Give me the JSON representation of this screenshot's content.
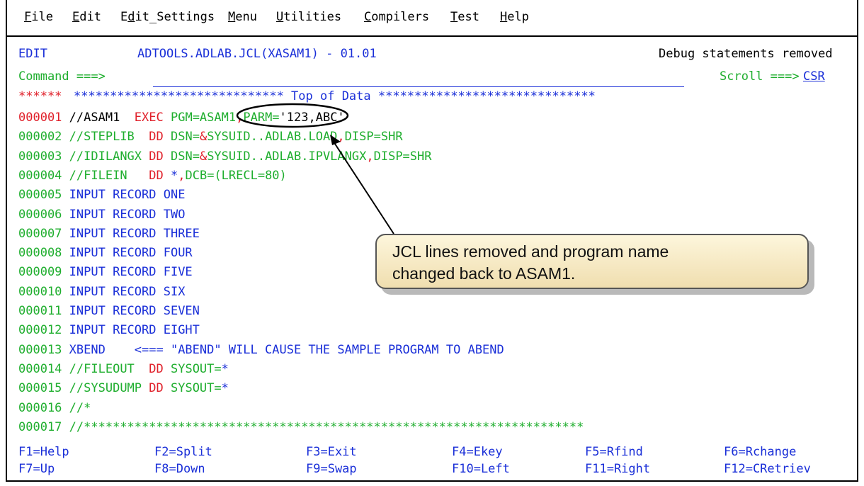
{
  "menu": [
    {
      "label": "File",
      "hot": "F",
      "rest": "ile"
    },
    {
      "label": "Edit",
      "hot": "E",
      "rest": "dit"
    },
    {
      "label": "Edit_Settings",
      "pre": "E",
      "hot": "d",
      "rest": "it_Settings"
    },
    {
      "label": "Menu",
      "hot": "M",
      "rest": "enu"
    },
    {
      "label": "Utilities",
      "hot": "U",
      "rest": "tilities"
    },
    {
      "label": "Compilers",
      "hot": "C",
      "rest": "ompilers"
    },
    {
      "label": "Test",
      "hot": "T",
      "rest": "est"
    },
    {
      "label": "Help",
      "hot": "H",
      "rest": "elp"
    }
  ],
  "header": {
    "mode": "EDIT",
    "dataset": "ADTOOLS.ADLAB.JCL(XASAM1) - 01.01",
    "message": "Debug statements removed",
    "command_label": "Command ===>",
    "command_value": "",
    "scroll_label": "Scroll ===>",
    "scroll_value": "CSR"
  },
  "top_of_data": {
    "stars_left": "******",
    "banner": "***************************** Top of Data ******************************"
  },
  "lines": [
    {
      "num": "000001",
      "parts": [
        [
          "black",
          "//ASAM1  "
        ],
        [
          "red",
          "EXEC "
        ],
        [
          "green",
          "PGM=ASAM1"
        ],
        [
          "red",
          ","
        ],
        [
          "green",
          "PARM="
        ],
        [
          "black",
          "'123,ABC'"
        ]
      ]
    },
    {
      "num": "000002",
      "parts": [
        [
          "green",
          "//STEPLIB  "
        ],
        [
          "red",
          "DD "
        ],
        [
          "green",
          "DSN="
        ],
        [
          "red",
          "&"
        ],
        [
          "green",
          "SYSUID..ADLAB.LOAD"
        ],
        [
          "red",
          ","
        ],
        [
          "green",
          "DISP=SHR"
        ]
      ]
    },
    {
      "num": "000003",
      "parts": [
        [
          "green",
          "//IDILANGX "
        ],
        [
          "red",
          "DD "
        ],
        [
          "green",
          "DSN="
        ],
        [
          "red",
          "&"
        ],
        [
          "green",
          "SYSUID..ADLAB.IPVLANGX"
        ],
        [
          "red",
          ","
        ],
        [
          "green",
          "DISP=SHR"
        ]
      ]
    },
    {
      "num": "000004",
      "parts": [
        [
          "green",
          "//FILEIN   "
        ],
        [
          "red",
          "DD "
        ],
        [
          "blue",
          "*"
        ],
        [
          "red",
          ","
        ],
        [
          "green",
          "DCB=(LRECL=80)"
        ]
      ]
    },
    {
      "num": "000005",
      "parts": [
        [
          "blue",
          "INPUT RECORD ONE"
        ]
      ]
    },
    {
      "num": "000006",
      "parts": [
        [
          "blue",
          "INPUT RECORD TWO"
        ]
      ]
    },
    {
      "num": "000007",
      "parts": [
        [
          "blue",
          "INPUT RECORD THREE"
        ]
      ]
    },
    {
      "num": "000008",
      "parts": [
        [
          "blue",
          "INPUT RECORD FOUR"
        ]
      ]
    },
    {
      "num": "000009",
      "parts": [
        [
          "blue",
          "INPUT RECORD FIVE"
        ]
      ]
    },
    {
      "num": "000010",
      "parts": [
        [
          "blue",
          "INPUT RECORD SIX"
        ]
      ]
    },
    {
      "num": "000011",
      "parts": [
        [
          "blue",
          "INPUT RECORD SEVEN"
        ]
      ]
    },
    {
      "num": "000012",
      "parts": [
        [
          "blue",
          "INPUT RECORD EIGHT"
        ]
      ]
    },
    {
      "num": "000013",
      "parts": [
        [
          "blue",
          "XBEND    <=== \"ABEND\" WILL CAUSE THE SAMPLE PROGRAM TO ABEND"
        ]
      ]
    },
    {
      "num": "000014",
      "parts": [
        [
          "green",
          "//FILEOUT  "
        ],
        [
          "red",
          "DD "
        ],
        [
          "green",
          "SYSOUT="
        ],
        [
          "blue",
          "*"
        ]
      ]
    },
    {
      "num": "000015",
      "parts": [
        [
          "green",
          "//SYSUDUMP "
        ],
        [
          "red",
          "DD "
        ],
        [
          "green",
          "SYSOUT="
        ],
        [
          "blue",
          "*"
        ]
      ]
    },
    {
      "num": "000016",
      "parts": [
        [
          "green",
          "//*"
        ]
      ]
    },
    {
      "num": "000017",
      "parts": [
        [
          "green",
          "//*********************************************************************"
        ]
      ]
    }
  ],
  "fkeys_row1": [
    "F1=Help",
    "F2=Split",
    "F3=Exit",
    "F4=Ekey",
    "F5=Rfind",
    "F6=Rchange"
  ],
  "fkeys_row2": [
    "F7=Up",
    "F8=Down",
    "F9=Swap",
    "F10=Left",
    "F11=Right",
    "F12=CRetriev"
  ],
  "callout": {
    "line1": "JCL lines removed and program name",
    "line2": "changed back to ASAM1."
  },
  "colors": {
    "red": "#e0202a",
    "green": "#1fae2e",
    "blue": "#1a2fd8",
    "callout_bg": "#f5e6bd"
  }
}
